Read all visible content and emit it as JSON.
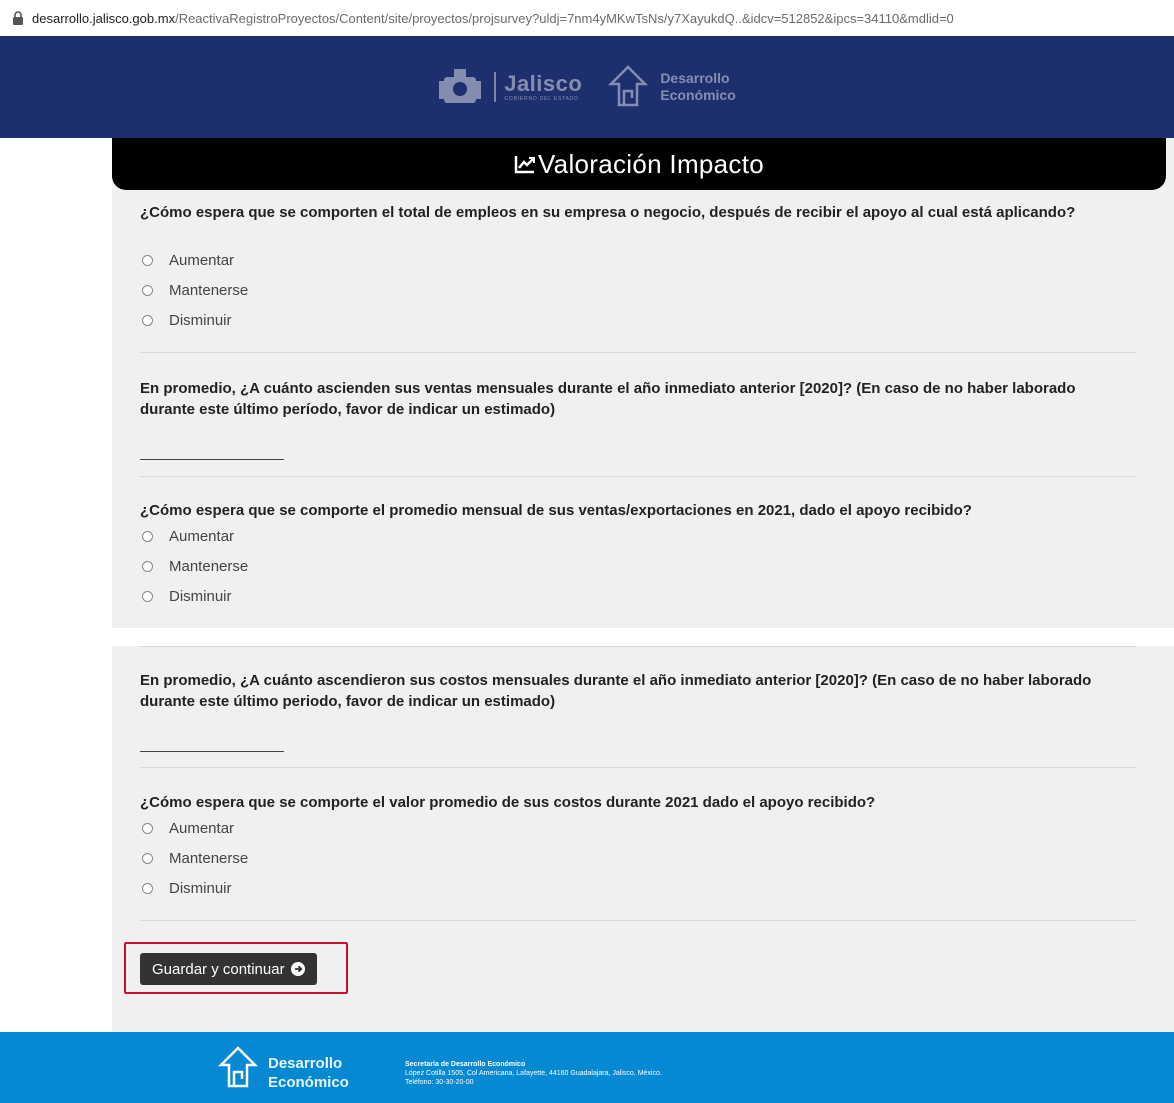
{
  "browser": {
    "url_host": "desarrollo.jalisco.gob.mx",
    "url_path": "/ReactivaRegistroProyectos/Content/site/proyectos/projsurvey?uldj=7nm4yMKwTsNs/y7XayukdQ..&idcv=512852&ipcs=34110&mdlid=0"
  },
  "header": {
    "jalisco": "Jalisco",
    "jalisco_sub": "GOBIERNO DEL ESTADO",
    "de_line1": "Desarrollo",
    "de_line2": "Económico"
  },
  "page": {
    "title": "Valoración Impacto"
  },
  "questions": [
    {
      "text": "¿Cómo espera que se comporten el total de empleos en su empresa o negocio, después de recibir el apoyo al cual está aplicando?",
      "options": [
        "Aumentar",
        "Mantenerse",
        "Disminuir"
      ]
    },
    {
      "text": "En promedio, ¿A cuánto ascienden sus ventas mensuales durante el año inmediato anterior [2020]? (En caso de no haber laborado durante este último período, favor de indicar un estimado)",
      "value": ""
    },
    {
      "text": "¿Cómo espera que se comporte el promedio mensual de sus ventas/exportaciones en 2021, dado el apoyo recibido?",
      "options": [
        "Aumentar",
        "Mantenerse",
        "Disminuir"
      ]
    },
    {
      "text": "En promedio, ¿A cuánto ascendieron sus costos mensuales durante el año inmediato anterior [2020]? (En caso de no haber laborado durante este último periodo, favor de indicar un estimado)",
      "value": ""
    },
    {
      "text": "¿Cómo espera que se comporte el valor promedio de sus costos durante 2021 dado el apoyo recibido?",
      "options": [
        "Aumentar",
        "Mantenerse",
        "Disminuir"
      ]
    }
  ],
  "actions": {
    "save_label": "Guardar y continuar"
  },
  "footer": {
    "brand_line1": "Desarrollo",
    "brand_line2": "Económico",
    "org": "Secretaría de Desarrollo Económico",
    "address": "López Cotilla 1505, Col Americana, Lafayette, 44160 Guadalajara, Jalisco, México.",
    "phone": "Teléfono: 30-30-20-00"
  },
  "colors": {
    "header_bg": "#1e2f6d",
    "footer_bg": "#0589d2",
    "highlight": "#c8102e"
  }
}
